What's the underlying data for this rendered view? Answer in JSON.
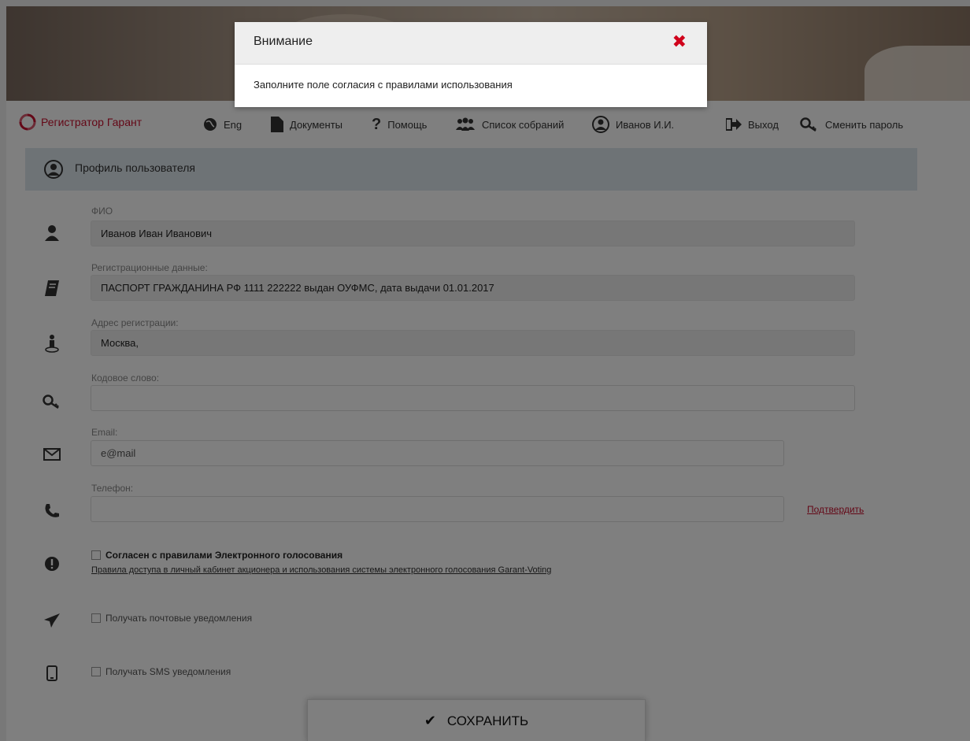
{
  "brand": {
    "name": "Регистратор Гарант",
    "color": "#c8102e"
  },
  "nav": {
    "lang": "Eng",
    "documents": "Документы",
    "help": "Помощь",
    "meetings": "Список собраний",
    "user": "Иванов И.И.",
    "logout": "Выход",
    "change_password": "Сменить пароль"
  },
  "profile": {
    "title": "Профиль пользователя",
    "fio": {
      "label": "ФИО",
      "value": "Иванов Иван Иванович"
    },
    "reg_data": {
      "label": "Регистрационные данные:",
      "value": "ПАСПОРТ ГРАЖДАНИНА РФ 1111 222222 выдан ОУФМС, дата выдачи 01.01.2017"
    },
    "address": {
      "label": "Адрес регистрации:",
      "value": "Москва,"
    },
    "code_word": {
      "label": "Кодовое слово:",
      "value": ""
    },
    "email": {
      "label": "Email:",
      "value": "e@mail"
    },
    "phone": {
      "label": "Телефон:",
      "value": "",
      "confirm_link": "Подтвердить"
    },
    "agree": {
      "label": "Согласен с правилами Электронного голосования",
      "rules_link": "Правила доступа в личный кабинет акционера и использования системы электронного голосования Garant-Voting"
    },
    "mail_notifications": "Получать почтовые уведомления",
    "sms_notifications": "Получать SMS уведомления",
    "save": "СОХРАНИТЬ"
  },
  "modal": {
    "title": "Внимание",
    "message": "Заполните поле согласия с правилами использования",
    "close_icon": "close-icon"
  },
  "colors": {
    "accent_red": "#c8102e",
    "overlay": "rgba(0,0,0,0.5)",
    "profile_bar": "#dde6ed"
  }
}
